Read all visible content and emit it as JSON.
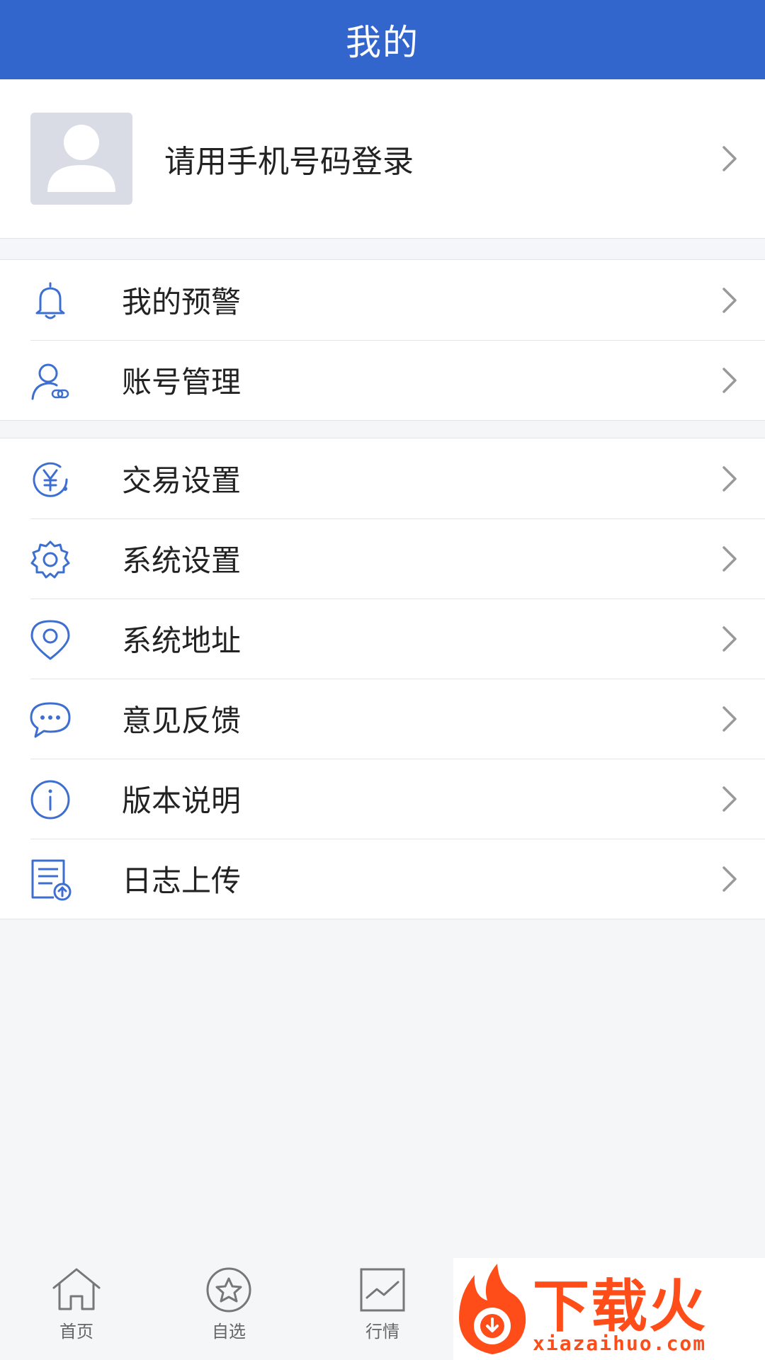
{
  "header": {
    "title": "我的"
  },
  "profile": {
    "login_prompt": "请用手机号码登录"
  },
  "section1": {
    "items": [
      {
        "label": "我的预警",
        "icon": "bell-icon"
      },
      {
        "label": "账号管理",
        "icon": "user-link-icon"
      }
    ]
  },
  "section2": {
    "items": [
      {
        "label": "交易设置",
        "icon": "yen-icon"
      },
      {
        "label": "系统设置",
        "icon": "gear-icon"
      },
      {
        "label": "系统地址",
        "icon": "location-icon"
      },
      {
        "label": "意见反馈",
        "icon": "chat-bubble-icon"
      },
      {
        "label": "版本说明",
        "icon": "info-icon"
      },
      {
        "label": "日志上传",
        "icon": "log-upload-icon"
      }
    ]
  },
  "tabbar": {
    "tabs": [
      {
        "label": "首页",
        "icon": "home-icon"
      },
      {
        "label": "自选",
        "icon": "star-icon"
      },
      {
        "label": "行情",
        "icon": "chart-icon"
      }
    ]
  },
  "watermark": {
    "brand": "下载火",
    "url": "xiazaihuo.com"
  },
  "colors": {
    "header_bg": "#3366cc",
    "icon_blue": "#3d6fd1",
    "page_bg": "#f5f6f8"
  }
}
